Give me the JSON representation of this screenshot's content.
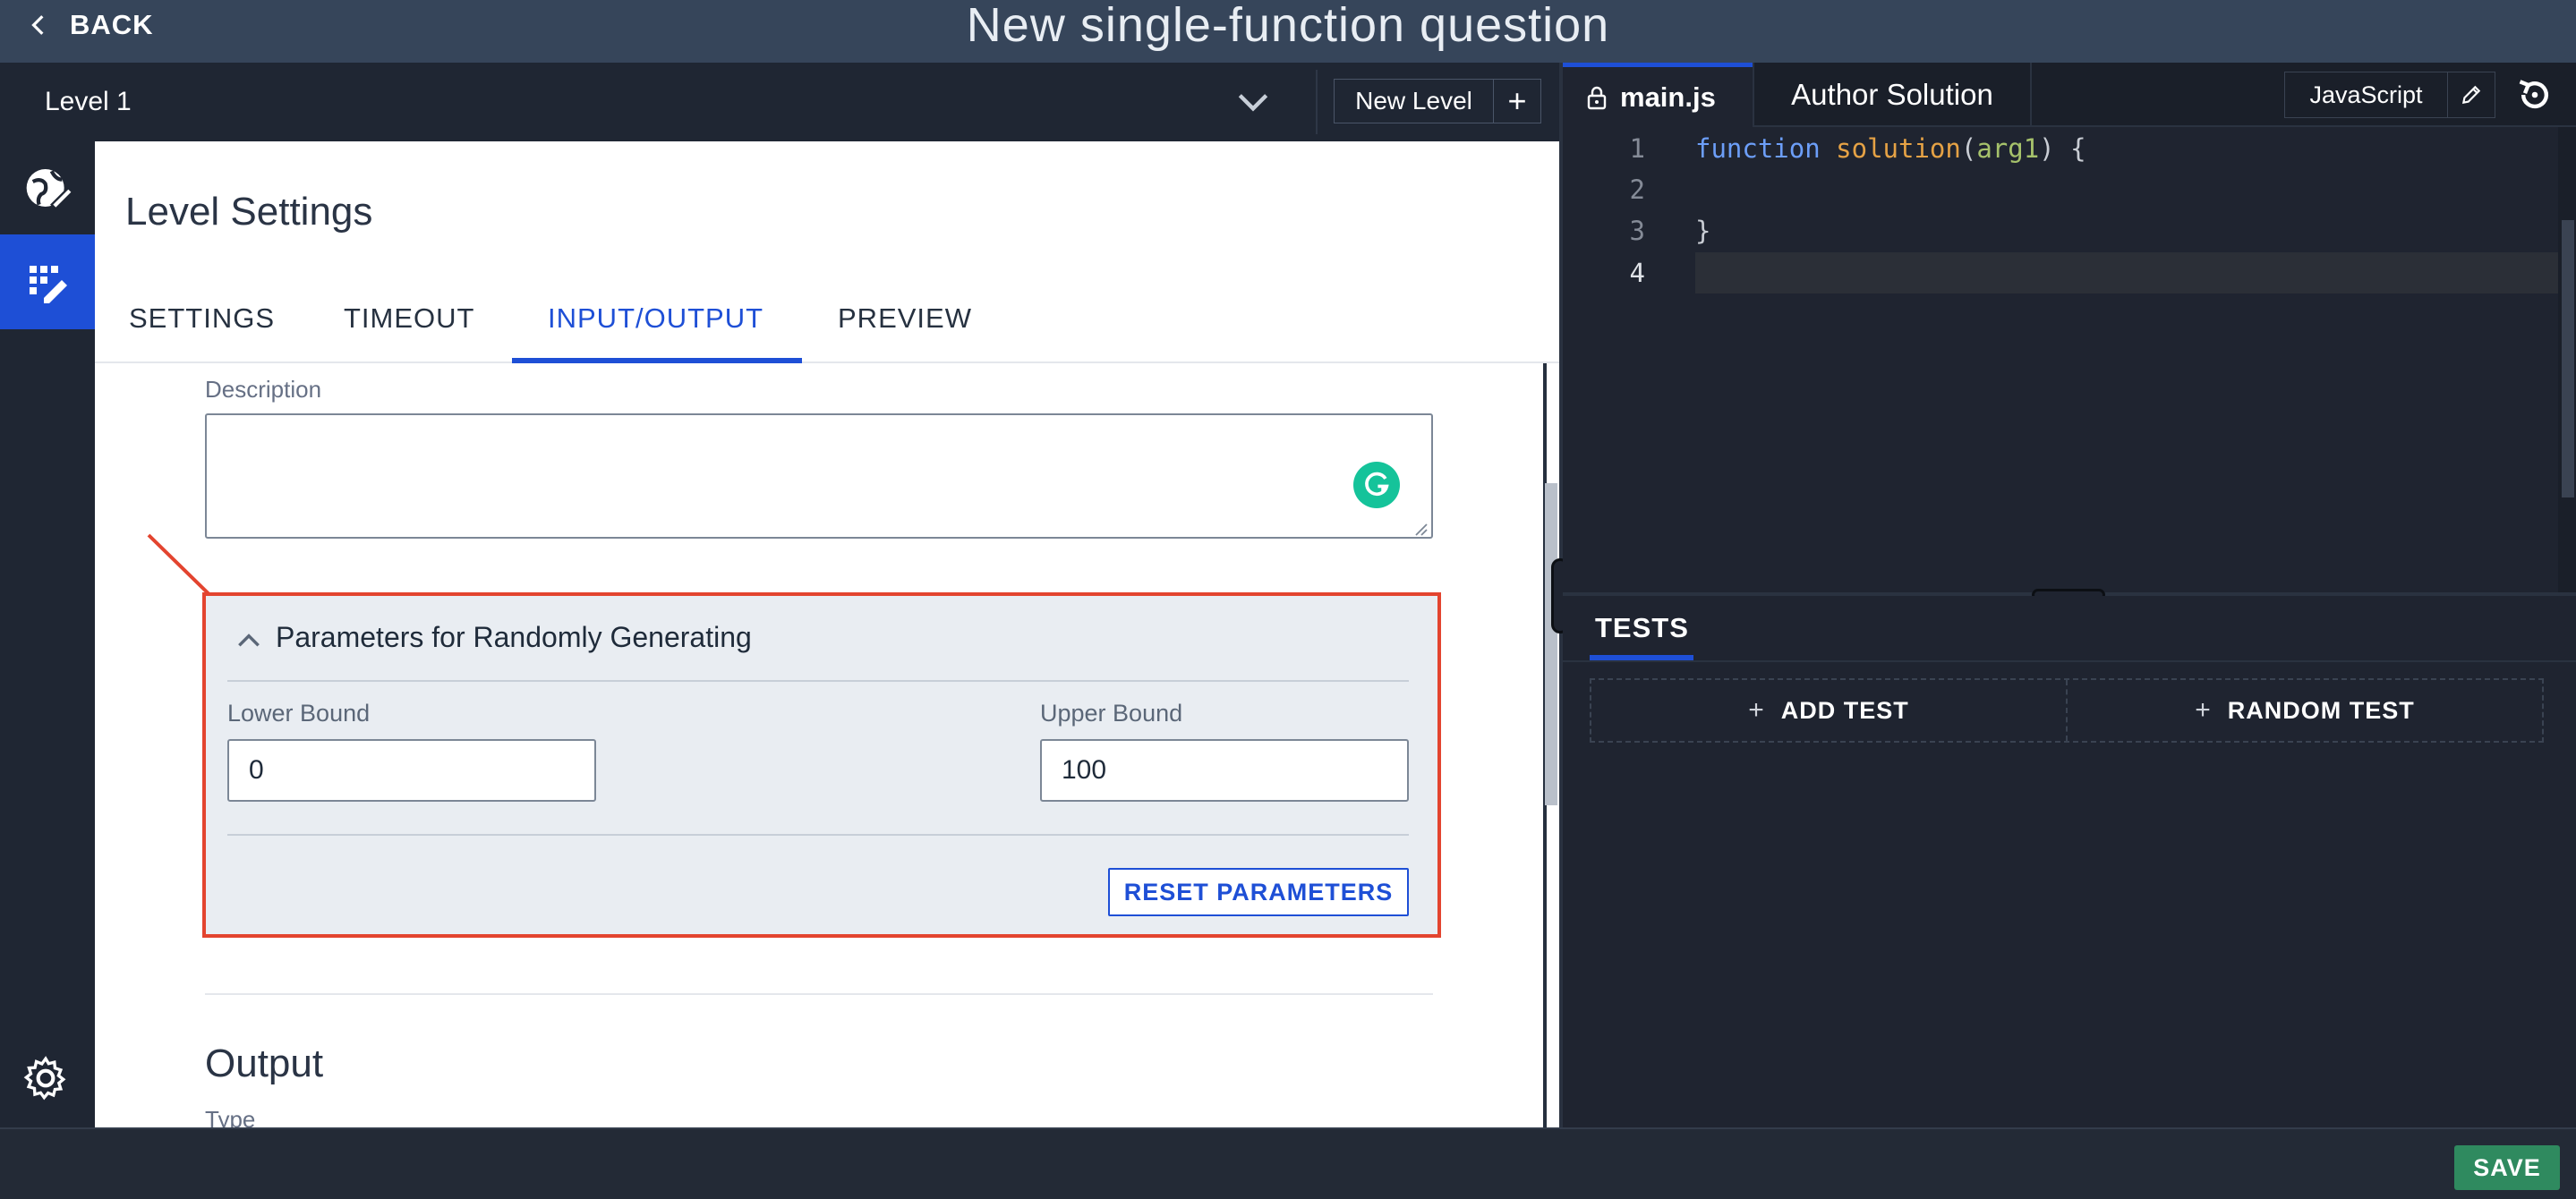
{
  "header": {
    "back_label": "BACK",
    "title": "New single-function question"
  },
  "level_bar": {
    "level_name": "Level 1",
    "new_level_label": "New Level",
    "add_symbol": "+"
  },
  "level_settings": {
    "title": "Level Settings",
    "tabs": [
      {
        "label": "SETTINGS"
      },
      {
        "label": "TIMEOUT"
      },
      {
        "label": "INPUT/OUTPUT"
      },
      {
        "label": "PREVIEW"
      }
    ],
    "active_tab": "INPUT/OUTPUT",
    "description_label": "Description",
    "description_value": "",
    "params": {
      "title": "Parameters for Randomly Generating",
      "lower_label": "Lower Bound",
      "lower_value": "0",
      "upper_label": "Upper Bound",
      "upper_value": "100",
      "reset_label": "RESET PARAMETERS"
    },
    "output_title": "Output",
    "type_label": "Type"
  },
  "editor": {
    "file_tab": "main.js",
    "author_tab": "Author Solution",
    "language": "JavaScript",
    "line_numbers": [
      "1",
      "2",
      "3",
      "4"
    ],
    "code": {
      "line1_kw": "function",
      "line1_fn": "solution",
      "line1_open": "(",
      "line1_arg": "arg1",
      "line1_close": ") {",
      "line3": "}"
    }
  },
  "tests": {
    "tab_label": "TESTS",
    "add_test_label": "ADD TEST",
    "random_test_label": "RANDOM TEST",
    "plus_symbol": "+"
  },
  "footer": {
    "save_label": "SAVE"
  },
  "colors": {
    "accent": "#1e4fd6",
    "highlight_border": "#e3442f",
    "save_green": "#2f8a5f"
  }
}
